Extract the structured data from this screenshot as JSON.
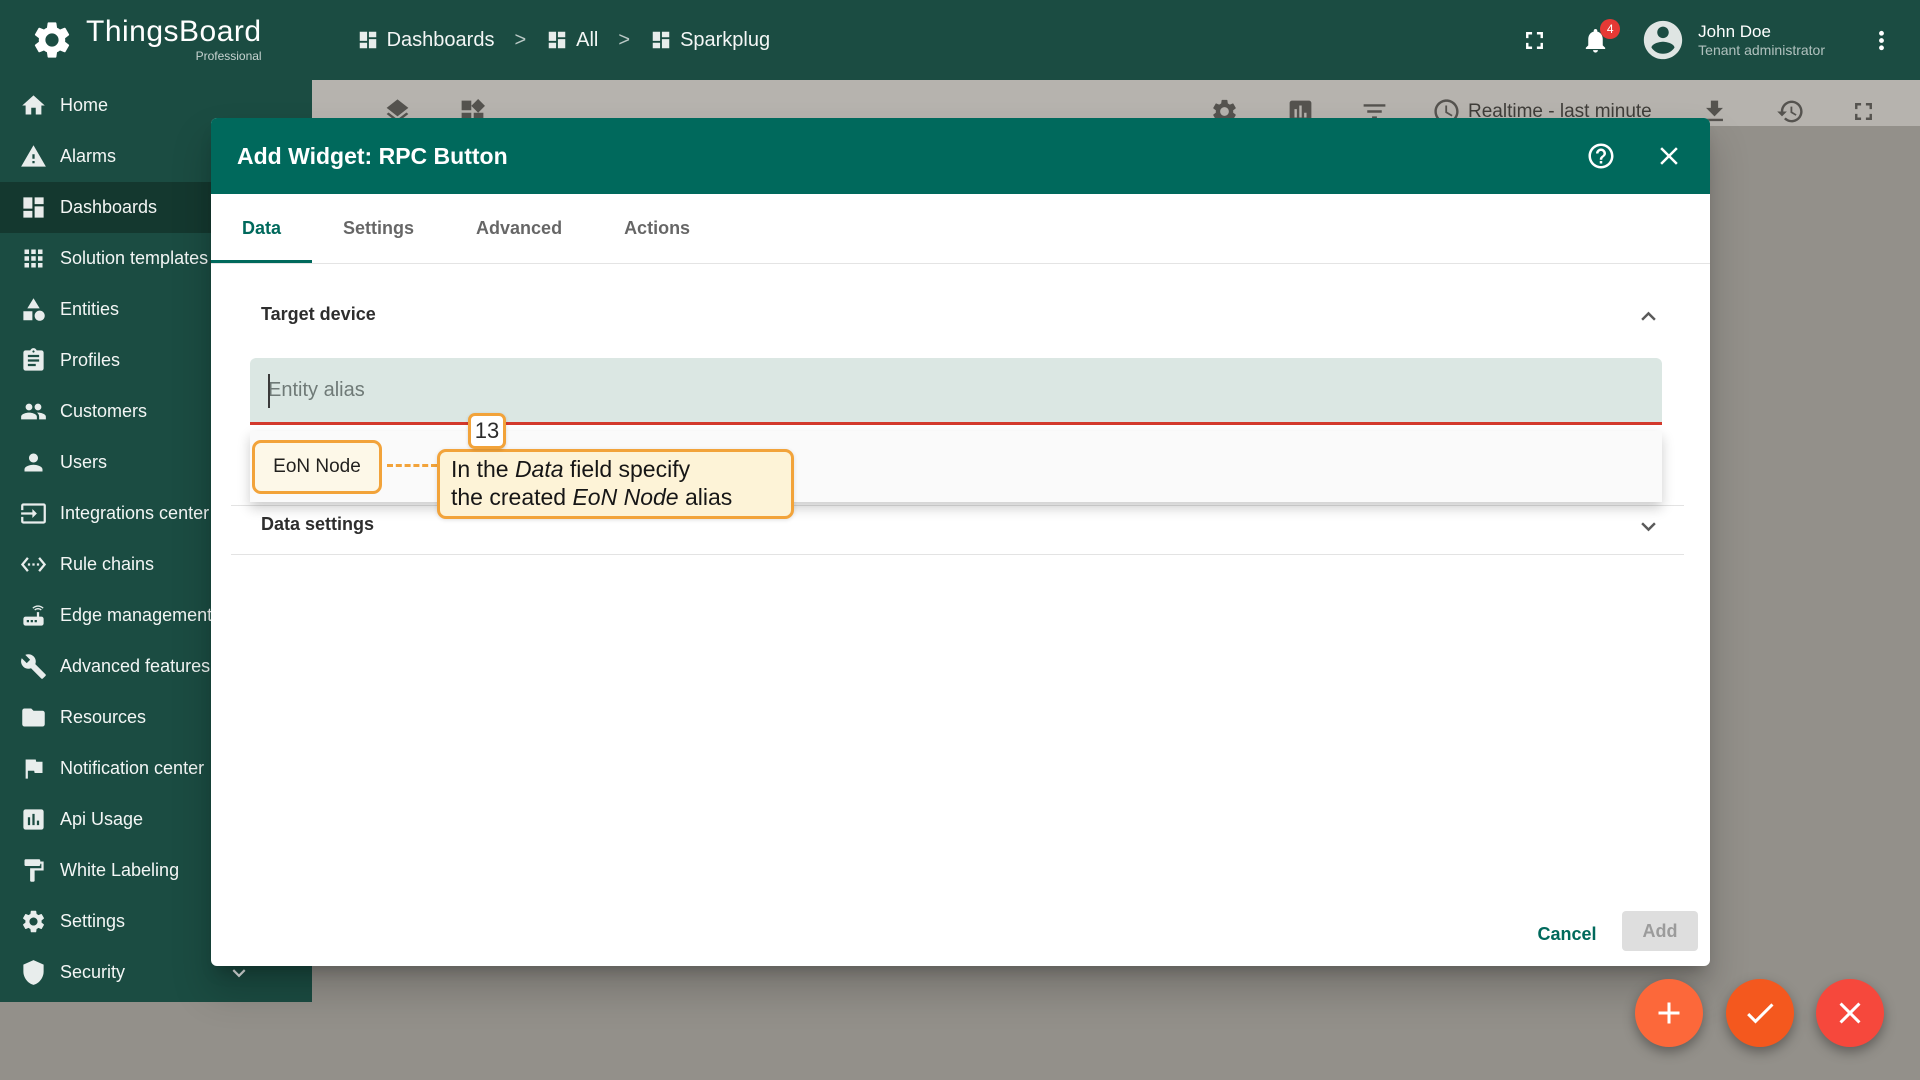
{
  "colors": {
    "header_bg": "#1b4c42",
    "sidebar_active_bg": "#14382f",
    "modal_header_bg": "#00695c",
    "accent": "#00695c",
    "error_red": "#d3392c",
    "tutorial_orange": "#f2a33a",
    "tutorial_callout_bg": "#fdf3d7",
    "input_bg": "#dbe7e3",
    "dim_body": "#93908a",
    "dim_toolbar": "#b6b3ae",
    "badge_red": "#e53935",
    "fab_add": "#fc683a",
    "fab_check": "#f4581e",
    "fab_close": "#f6483c"
  },
  "header": {
    "logo_title": "ThingsBoard",
    "logo_subtitle": "Professional",
    "separator": ">",
    "breadcrumb": [
      {
        "label": "Dashboards",
        "icon": "dashboards-icon"
      },
      {
        "label": "All",
        "icon": "dashboards-icon"
      },
      {
        "label": "Sparkplug",
        "icon": "dashboards-icon"
      }
    ],
    "notification_count": "4",
    "user_name": "John Doe",
    "user_role": "Tenant administrator"
  },
  "sidebar": {
    "items": [
      {
        "label": "Home",
        "icon": "home-icon"
      },
      {
        "label": "Alarms",
        "icon": "warning-icon"
      },
      {
        "label": "Dashboards",
        "icon": "dashboards-icon",
        "active": true
      },
      {
        "label": "Solution templates",
        "icon": "apps-icon"
      },
      {
        "label": "Entities",
        "icon": "category-icon"
      },
      {
        "label": "Profiles",
        "icon": "assignment-icon"
      },
      {
        "label": "Customers",
        "icon": "people-icon"
      },
      {
        "label": "Users",
        "icon": "person-icon"
      },
      {
        "label": "Integrations center",
        "icon": "input-icon"
      },
      {
        "label": "Rule chains",
        "icon": "ethernet-icon"
      },
      {
        "label": "Edge management",
        "icon": "router-icon"
      },
      {
        "label": "Advanced features",
        "icon": "wrench-icon"
      },
      {
        "label": "Resources",
        "icon": "folder-icon"
      },
      {
        "label": "Notification center",
        "icon": "flag-icon"
      },
      {
        "label": "Api Usage",
        "icon": "chart-icon"
      },
      {
        "label": "White Labeling",
        "icon": "paint-icon"
      },
      {
        "label": "Settings",
        "icon": "gear-icon"
      },
      {
        "label": "Security",
        "icon": "shield-icon",
        "expandable": true
      }
    ]
  },
  "dashboard_toolbar": {
    "timewindow_label": "Realtime - last minute"
  },
  "modal": {
    "title": "Add Widget: RPC Button",
    "tabs": [
      {
        "label": "Data",
        "active": true
      },
      {
        "label": "Settings"
      },
      {
        "label": "Advanced"
      },
      {
        "label": "Actions"
      }
    ],
    "target_device": {
      "title": "Target device",
      "entity_alias_placeholder": "Entity alias",
      "autocomplete_option": "EoN Node"
    },
    "data_settings": {
      "title": "Data settings"
    },
    "footer": {
      "cancel_label": "Cancel",
      "add_label": "Add"
    }
  },
  "tutorial": {
    "step_number": "13",
    "callout": {
      "l1a": "In the ",
      "l1b": "Data",
      "l1c": " field specify",
      "l2a": "the created ",
      "l2b": "EoN Node",
      "l2c": " alias"
    }
  }
}
